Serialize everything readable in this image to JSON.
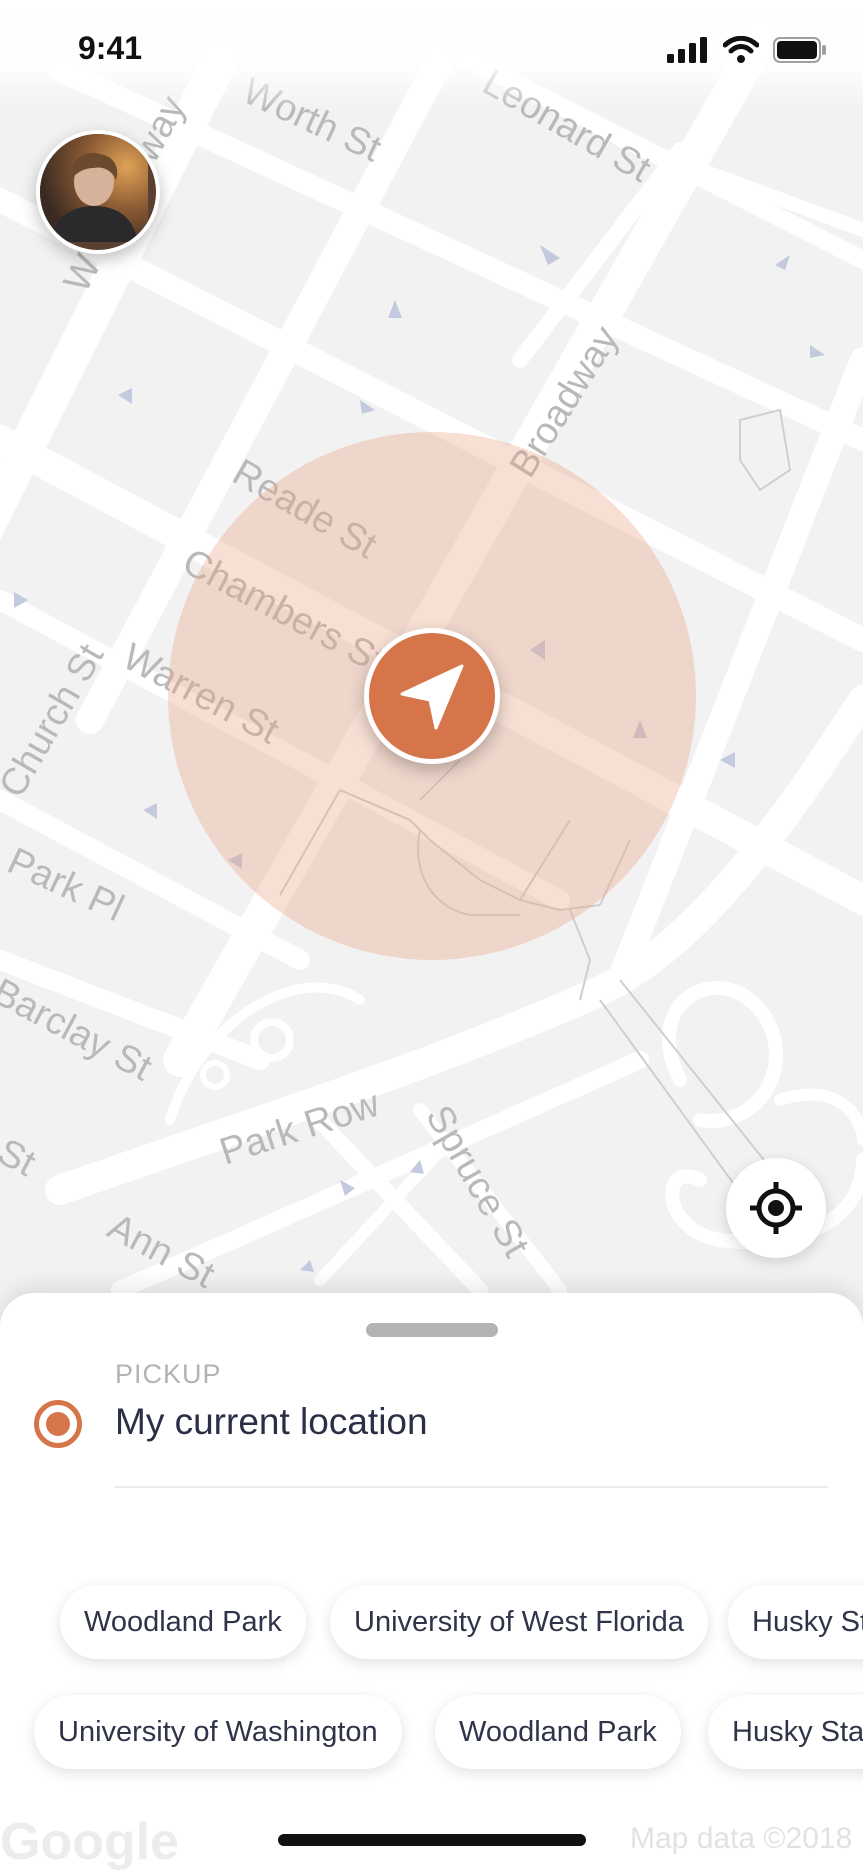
{
  "status_bar": {
    "time": "9:41"
  },
  "map": {
    "streets": [
      "Worth St",
      "Leonard St",
      "W Broadway",
      "Broadway",
      "Reade St",
      "Chambers St",
      "Warren St",
      "Church St",
      "Park Pl",
      "Barclay St",
      "St",
      "Park Row",
      "Spruce St",
      "Ann St"
    ],
    "accent_color": "#d6754a"
  },
  "pickup": {
    "label": "PICKUP",
    "value": "My current location"
  },
  "suggestions": {
    "row1": [
      "Woodland Park",
      "University of West Florida",
      "Husky Stadium"
    ],
    "row2": [
      "University of Washington",
      "Woodland Park",
      "Husky Stadium"
    ]
  },
  "attribution": {
    "google": "Google",
    "map_data": "Map data ©2018"
  }
}
